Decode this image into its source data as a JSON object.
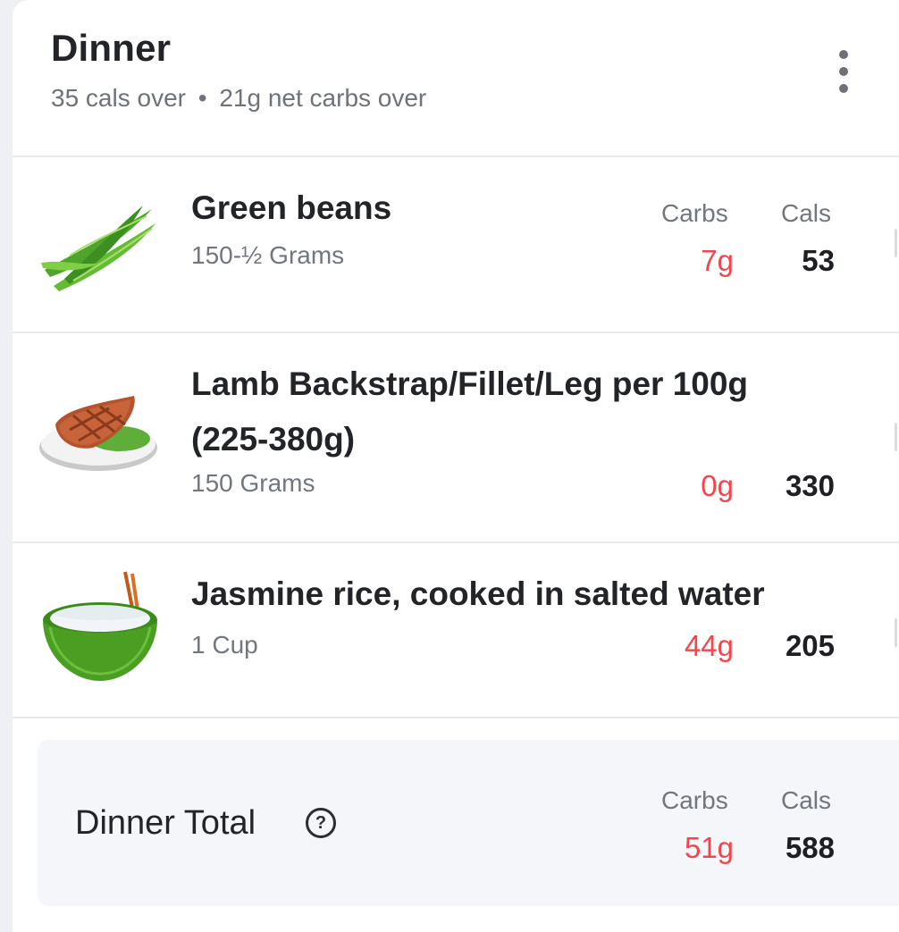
{
  "meal": {
    "title": "Dinner",
    "summary_cals": "35 cals over",
    "summary_sep": "•",
    "summary_carbs": "21g net carbs over"
  },
  "columns": {
    "carbs_label": "Carbs",
    "cals_label": "Cals"
  },
  "items": [
    {
      "name": "Green beans",
      "quantity": "150-½ Grams",
      "carbs": "7g",
      "cals": "53",
      "icon": "green-beans-icon"
    },
    {
      "name": "Lamb Backstrap/Fillet/Leg per 100g (225-380g)",
      "quantity": "150 Grams",
      "carbs": "0g",
      "cals": "330",
      "icon": "steak-plate-icon"
    },
    {
      "name": "Jasmine rice, cooked in salted water",
      "quantity": "1 Cup",
      "carbs": "44g",
      "cals": "205",
      "icon": "rice-bowl-icon"
    }
  ],
  "total": {
    "label": "Dinner Total",
    "help_icon": "question-circle-icon",
    "carbs_label": "Carbs",
    "cals_label": "Cals",
    "carbs": "51g",
    "cals": "588"
  },
  "colors": {
    "carbs_red": "#f0474f",
    "text_dark": "#222428",
    "text_muted": "#72767d",
    "total_bg": "#f5f6f9"
  }
}
